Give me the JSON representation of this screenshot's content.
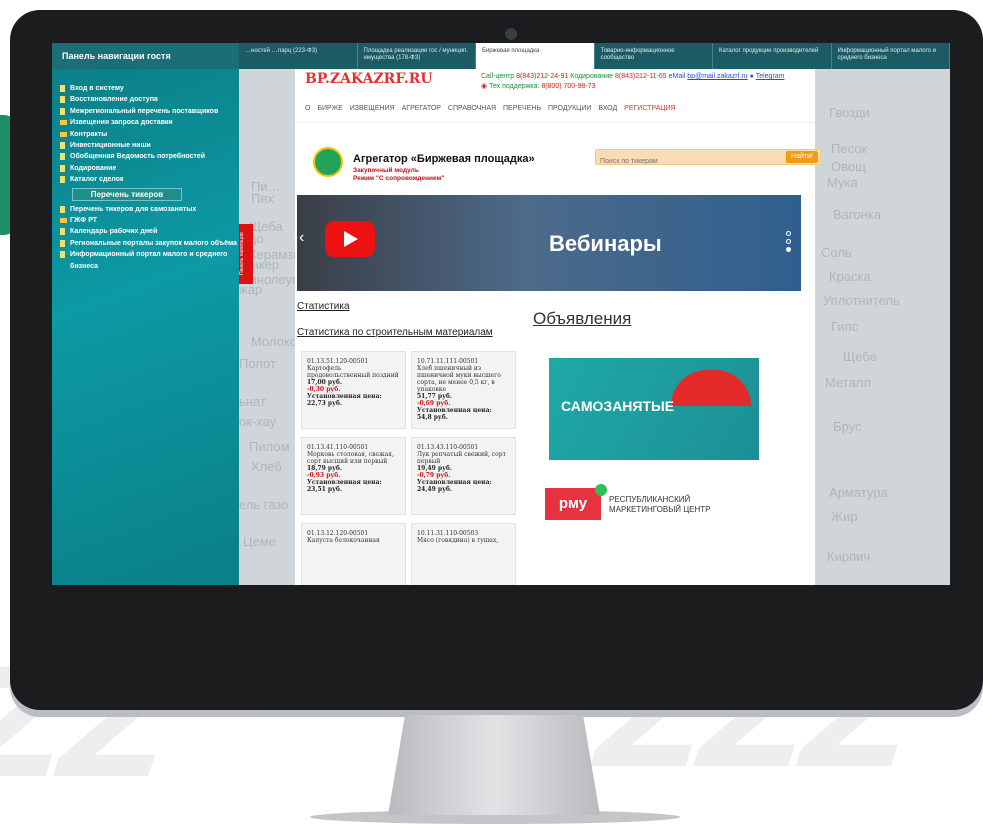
{
  "window": {
    "tabs": [
      {
        "label": "…ностей …ларц (223-ФЗ)",
        "active": false
      },
      {
        "label": "Площадка реализации гос / муницип. имущества (178-ФЗ)",
        "active": false
      },
      {
        "label": "Биржевая площадка",
        "active": true
      },
      {
        "label": "Товарно-информационное сообщество",
        "active": false
      },
      {
        "label": "Каталог продукции производителей",
        "active": false
      },
      {
        "label": "Информационный портал малого и среднего бизнеса",
        "active": false
      }
    ]
  },
  "sidebar": {
    "title": "Панель навигации гостя",
    "items": [
      {
        "label": "Вход в систему",
        "type": "page"
      },
      {
        "label": "Восстановление доступа",
        "type": "page"
      },
      {
        "label": "Межрегиональный перечень поставщиков",
        "type": "page"
      },
      {
        "label": "Извещения запроса доставки",
        "type": "folder"
      },
      {
        "label": "Контракты",
        "type": "folder"
      },
      {
        "label": "Инвестиционные ниши",
        "type": "page"
      },
      {
        "label": "Обобщенная Ведомость потребностей",
        "type": "page"
      },
      {
        "label": "Кодирование",
        "type": "page"
      },
      {
        "label": "Каталог сделок",
        "type": "page"
      }
    ],
    "selected": "Перечень тикеров",
    "items_after": [
      {
        "label": "Перечень тикеров для самозанятых",
        "type": "page"
      },
      {
        "label": "ГЖФ РТ",
        "type": "folder"
      },
      {
        "label": "Календарь рабочих дней",
        "type": "page"
      },
      {
        "label": "Региональные порталы закупок малого объёма",
        "type": "page"
      },
      {
        "label": "Информационный портал малого и среднего бизнеса",
        "type": "page"
      }
    ],
    "vertical_tab": "Панель навигации"
  },
  "header": {
    "logo": "BP.ZAKAZRF.RU",
    "callcenter_label": "Call-центр",
    "callcenter_phone": "8(843)212-24-91",
    "coding_label": "Кодирование",
    "coding_phone": "8(843)212-11-65",
    "email_label": "eMail",
    "email": "bp@mail.zakazrf.ru",
    "telegram": "Telegram",
    "support_label": "Тех поддержка:",
    "support_phone": "8(800) 700-98-73",
    "nav": [
      "О БИРЖЕ",
      "ИЗВЕЩЕНИЯ",
      "АГРЕГАТОР",
      "СПРАВОЧНАЯ",
      "ПЕРЕЧЕНЬ ПРОДУКЦИИ",
      "ВХОД",
      "РЕГИСТРАЦИЯ"
    ]
  },
  "aggregator": {
    "title": "Агрегатор «Биржевая площадка»",
    "module": "Закупочный модуль",
    "mode": "Режим \"С сопровождением\""
  },
  "search": {
    "placeholder": "Поиск по тикерам",
    "button": "Найти!"
  },
  "banner": {
    "text": "Вебинары"
  },
  "links": {
    "stats": "Статистика",
    "stats_construction": "Статистика по строительным материалам"
  },
  "ads": {
    "title": "Объявления",
    "samozanyatye": "САМОЗАНЯТЫЕ",
    "rmc_logo": "рму",
    "rmc_text_1": "РЕСПУБЛИКАНСКИЙ",
    "rmc_text_2": "МАРКЕТИНГОВЫЙ ЦЕНТР"
  },
  "cards": [
    {
      "code": "01.13.51.120-00501",
      "name": "Картофель продовольственный поздний",
      "price": "17,00 руб.",
      "delta": "-0,30 руб.",
      "label": "Установленная цена:",
      "set_price": "22,73 руб."
    },
    {
      "code": "10.71.11.111-00501",
      "name": "Хлеб пшеничный из пшеничной муки высшего сорта, не менее 0,5 кг, в упаковке",
      "price": "51,77 руб.",
      "delta": "-0,69 руб.",
      "label": "Установленная цена:",
      "set_price": "54,8 руб."
    },
    {
      "code": "01.13.41.110-00501",
      "name": "Морковь столовая, свежая, сорт высший или первый",
      "price": "18,79 руб.",
      "delta": "-0,93 руб.",
      "label": "Установленная цена:",
      "set_price": "23,51 руб."
    },
    {
      "code": "01.13.43.110-00501",
      "name": "Лук репчатый свежий, сорт первый",
      "price": "19,49 руб.",
      "delta": "-0,79 руб.",
      "label": "Установленная цена:",
      "set_price": "24,49 руб."
    },
    {
      "code": "01.13.12.120-00501",
      "name": "Капуста белокочанная",
      "price": "",
      "delta": "",
      "label": "",
      "set_price": ""
    },
    {
      "code": "10.11.31.110-00503",
      "name": "Мясо (говядина) в тушах,",
      "price": "",
      "delta": "",
      "label": "",
      "set_price": ""
    }
  ],
  "background_words": {
    "left": [
      "Пи…",
      "Пях",
      "Щеба",
      "цо",
      "Анкер",
      "Керамзи",
      "Молоко",
      "Полот",
      "ьнат",
      "ок-хау",
      "Пилом",
      "Хлеб",
      "ель газо",
      "Цеме",
      "жар",
      "Линолеум"
    ],
    "right": [
      "Гвозди",
      "Песок",
      "Овощ",
      "Мука",
      "Вагонка",
      "Соль",
      "Краска",
      "Уплотнитель",
      "Гипс",
      "Щебе",
      "Металл",
      "Брус",
      "Арматура",
      "Жир",
      "Кирпич"
    ]
  }
}
